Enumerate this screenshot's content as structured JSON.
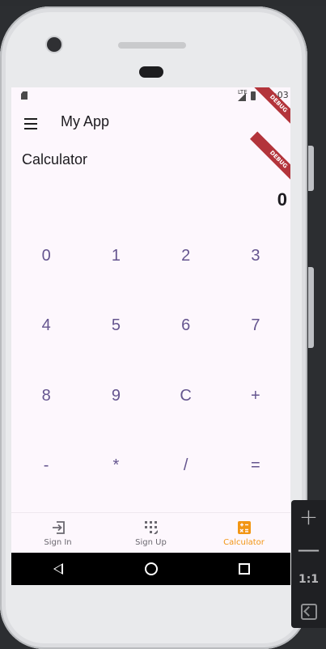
{
  "status_bar": {
    "clock": "5:03",
    "network": "LTE"
  },
  "app_bar": {
    "title": "My App"
  },
  "debug_banner": "DEBUG",
  "page": {
    "title": "Calculator",
    "display_value": "0"
  },
  "keypad": {
    "keys": [
      "0",
      "1",
      "2",
      "3",
      "4",
      "5",
      "6",
      "7",
      "8",
      "9",
      "C",
      "+",
      "-",
      "*",
      "/",
      "="
    ]
  },
  "bottom_nav": {
    "items": [
      {
        "label": "Sign In",
        "icon": "login-icon",
        "active": false
      },
      {
        "label": "Sign Up",
        "icon": "keypad-icon",
        "active": false
      },
      {
        "label": "Calculator",
        "icon": "calculator-icon",
        "active": true
      }
    ]
  },
  "zoom_controls": {
    "zoom_in": "+",
    "zoom_out": "—",
    "actual_size": "1:1"
  },
  "colors": {
    "primary": "#65558f",
    "active_nav": "#f29513",
    "surface": "#fdf7fd",
    "debug": "#b3343b"
  }
}
